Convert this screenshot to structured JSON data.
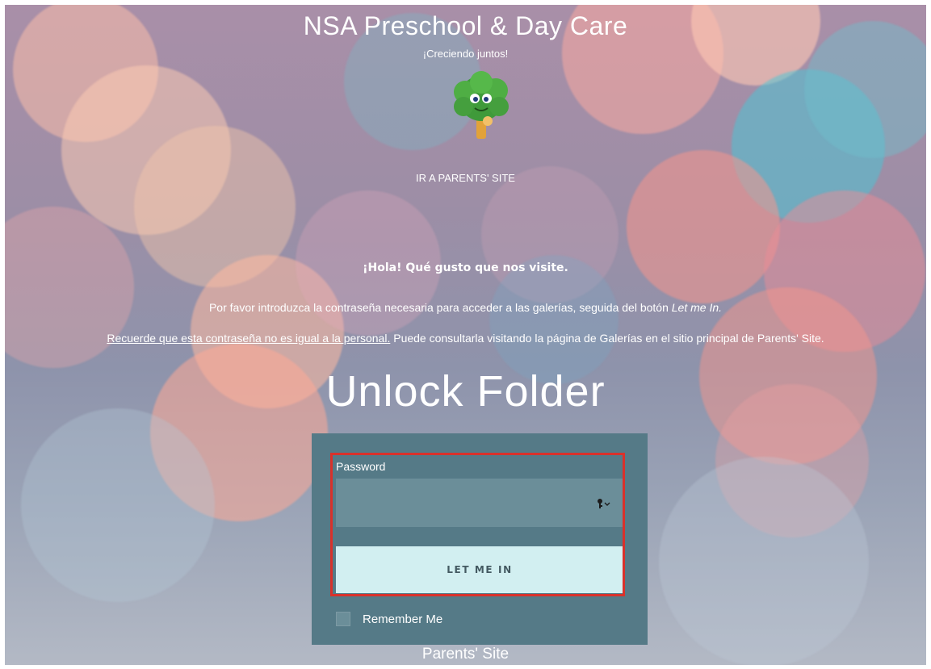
{
  "header": {
    "site_title": "NSA Preschool & Day Care",
    "tagline": "¡Creciendo juntos!",
    "parents_link": "IR A PARENTS' SITE"
  },
  "intro": {
    "greeting": "¡Hola! Qué gusto que nos visite.",
    "line1_prefix": "Por favor introduzca la contraseña necesaria para acceder a las galerías, seguida del botón ",
    "line1_emphasis": "Let me In.",
    "line2_underlined": "Recuerde que esta contraseña no es igual a la personal.",
    "line2_rest": " Puede consultarla visitando la página de Galerías en el sitio principal de Parents' Site."
  },
  "unlock_title": "Unlock Folder",
  "form": {
    "password_label": "Password",
    "password_value": "",
    "login_button": "LET ME IN",
    "remember_label": "Remember Me",
    "remember_checked": false,
    "key_icon": "key-dropdown-icon"
  },
  "footer": {
    "link": "Parents' Site"
  },
  "colors": {
    "panel": "#557a87",
    "input": "#6b8e99",
    "button": "#d2eff1",
    "highlight": "#d9312b"
  }
}
